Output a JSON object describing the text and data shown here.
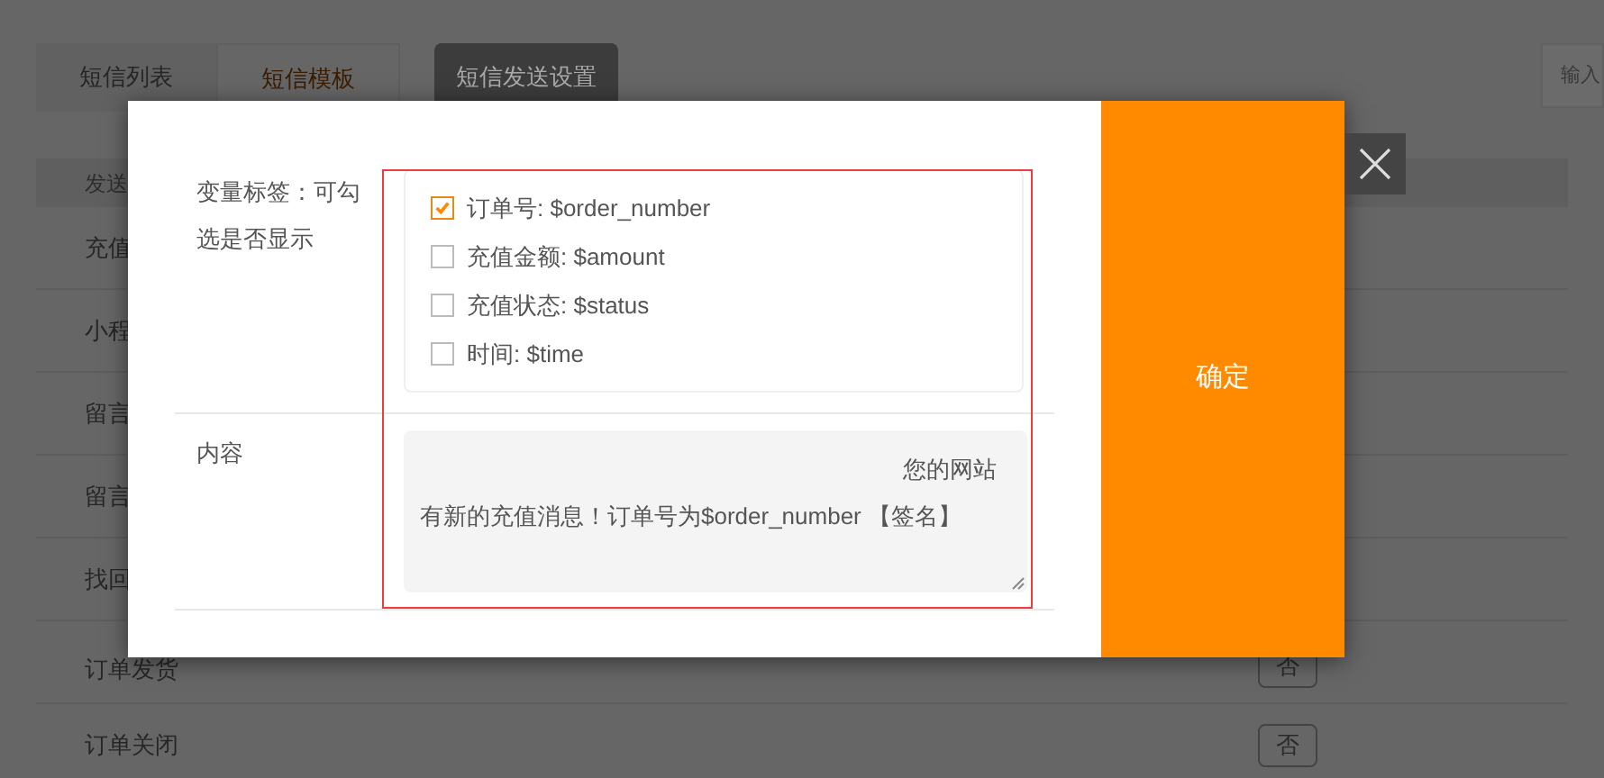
{
  "tabs": [
    {
      "label": "短信列表",
      "selected": false
    },
    {
      "label": "短信模板",
      "selected": true
    }
  ],
  "settings_button": "短信发送设置",
  "search": {
    "placeholder": "输入"
  },
  "table": {
    "header": "发送",
    "rows": [
      {
        "name": "充值"
      },
      {
        "name": "小程"
      },
      {
        "name": "留言"
      },
      {
        "name": "留言"
      },
      {
        "name": "找回"
      },
      {
        "name": "订单发货",
        "toggle": "否"
      },
      {
        "name": "订单关闭",
        "toggle": "否"
      }
    ]
  },
  "dialog": {
    "fields": [
      {
        "kind": "checklist",
        "label": "变量标签：可勾选是否显示",
        "options": [
          {
            "label": "订单号: $order_number",
            "checked": true
          },
          {
            "label": "充值金额: $amount",
            "checked": false
          },
          {
            "label": "充值状态: $status",
            "checked": false
          },
          {
            "label": "时间: $time",
            "checked": false
          }
        ]
      },
      {
        "kind": "textarea",
        "label": "内容",
        "lines": [
          "您的网站",
          "有新的充值消息！订单号为$order_number 【签名】"
        ]
      }
    ],
    "confirm": "确定"
  }
}
